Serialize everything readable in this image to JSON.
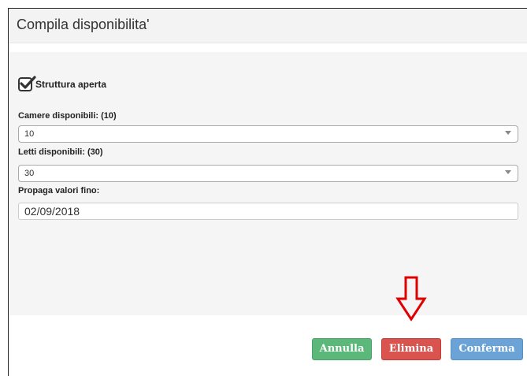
{
  "dialog": {
    "title": "Compila disponibilita'"
  },
  "form": {
    "checkbox": {
      "label": "Struttura aperta",
      "checked": true
    },
    "camere": {
      "label": "Camere disponibili: (10)",
      "value": "10"
    },
    "letti": {
      "label": "Letti disponibili: (30)",
      "value": "30"
    },
    "propaga": {
      "label": "Propaga valori fino:",
      "value": "02/09/2018"
    }
  },
  "footer": {
    "annulla_label": "Annulla",
    "elimina_label": "Elimina",
    "conferma_label": "Conferma"
  },
  "colors": {
    "annulla": "#5cb87a",
    "elimina": "#d9534f",
    "conferma": "#6ba3d6",
    "annotation_arrow": "#e00000"
  },
  "icons": {
    "checkbox": "check-icon",
    "select_arrow": "chevron-down-icon",
    "annotation": "arrow-down-icon"
  }
}
